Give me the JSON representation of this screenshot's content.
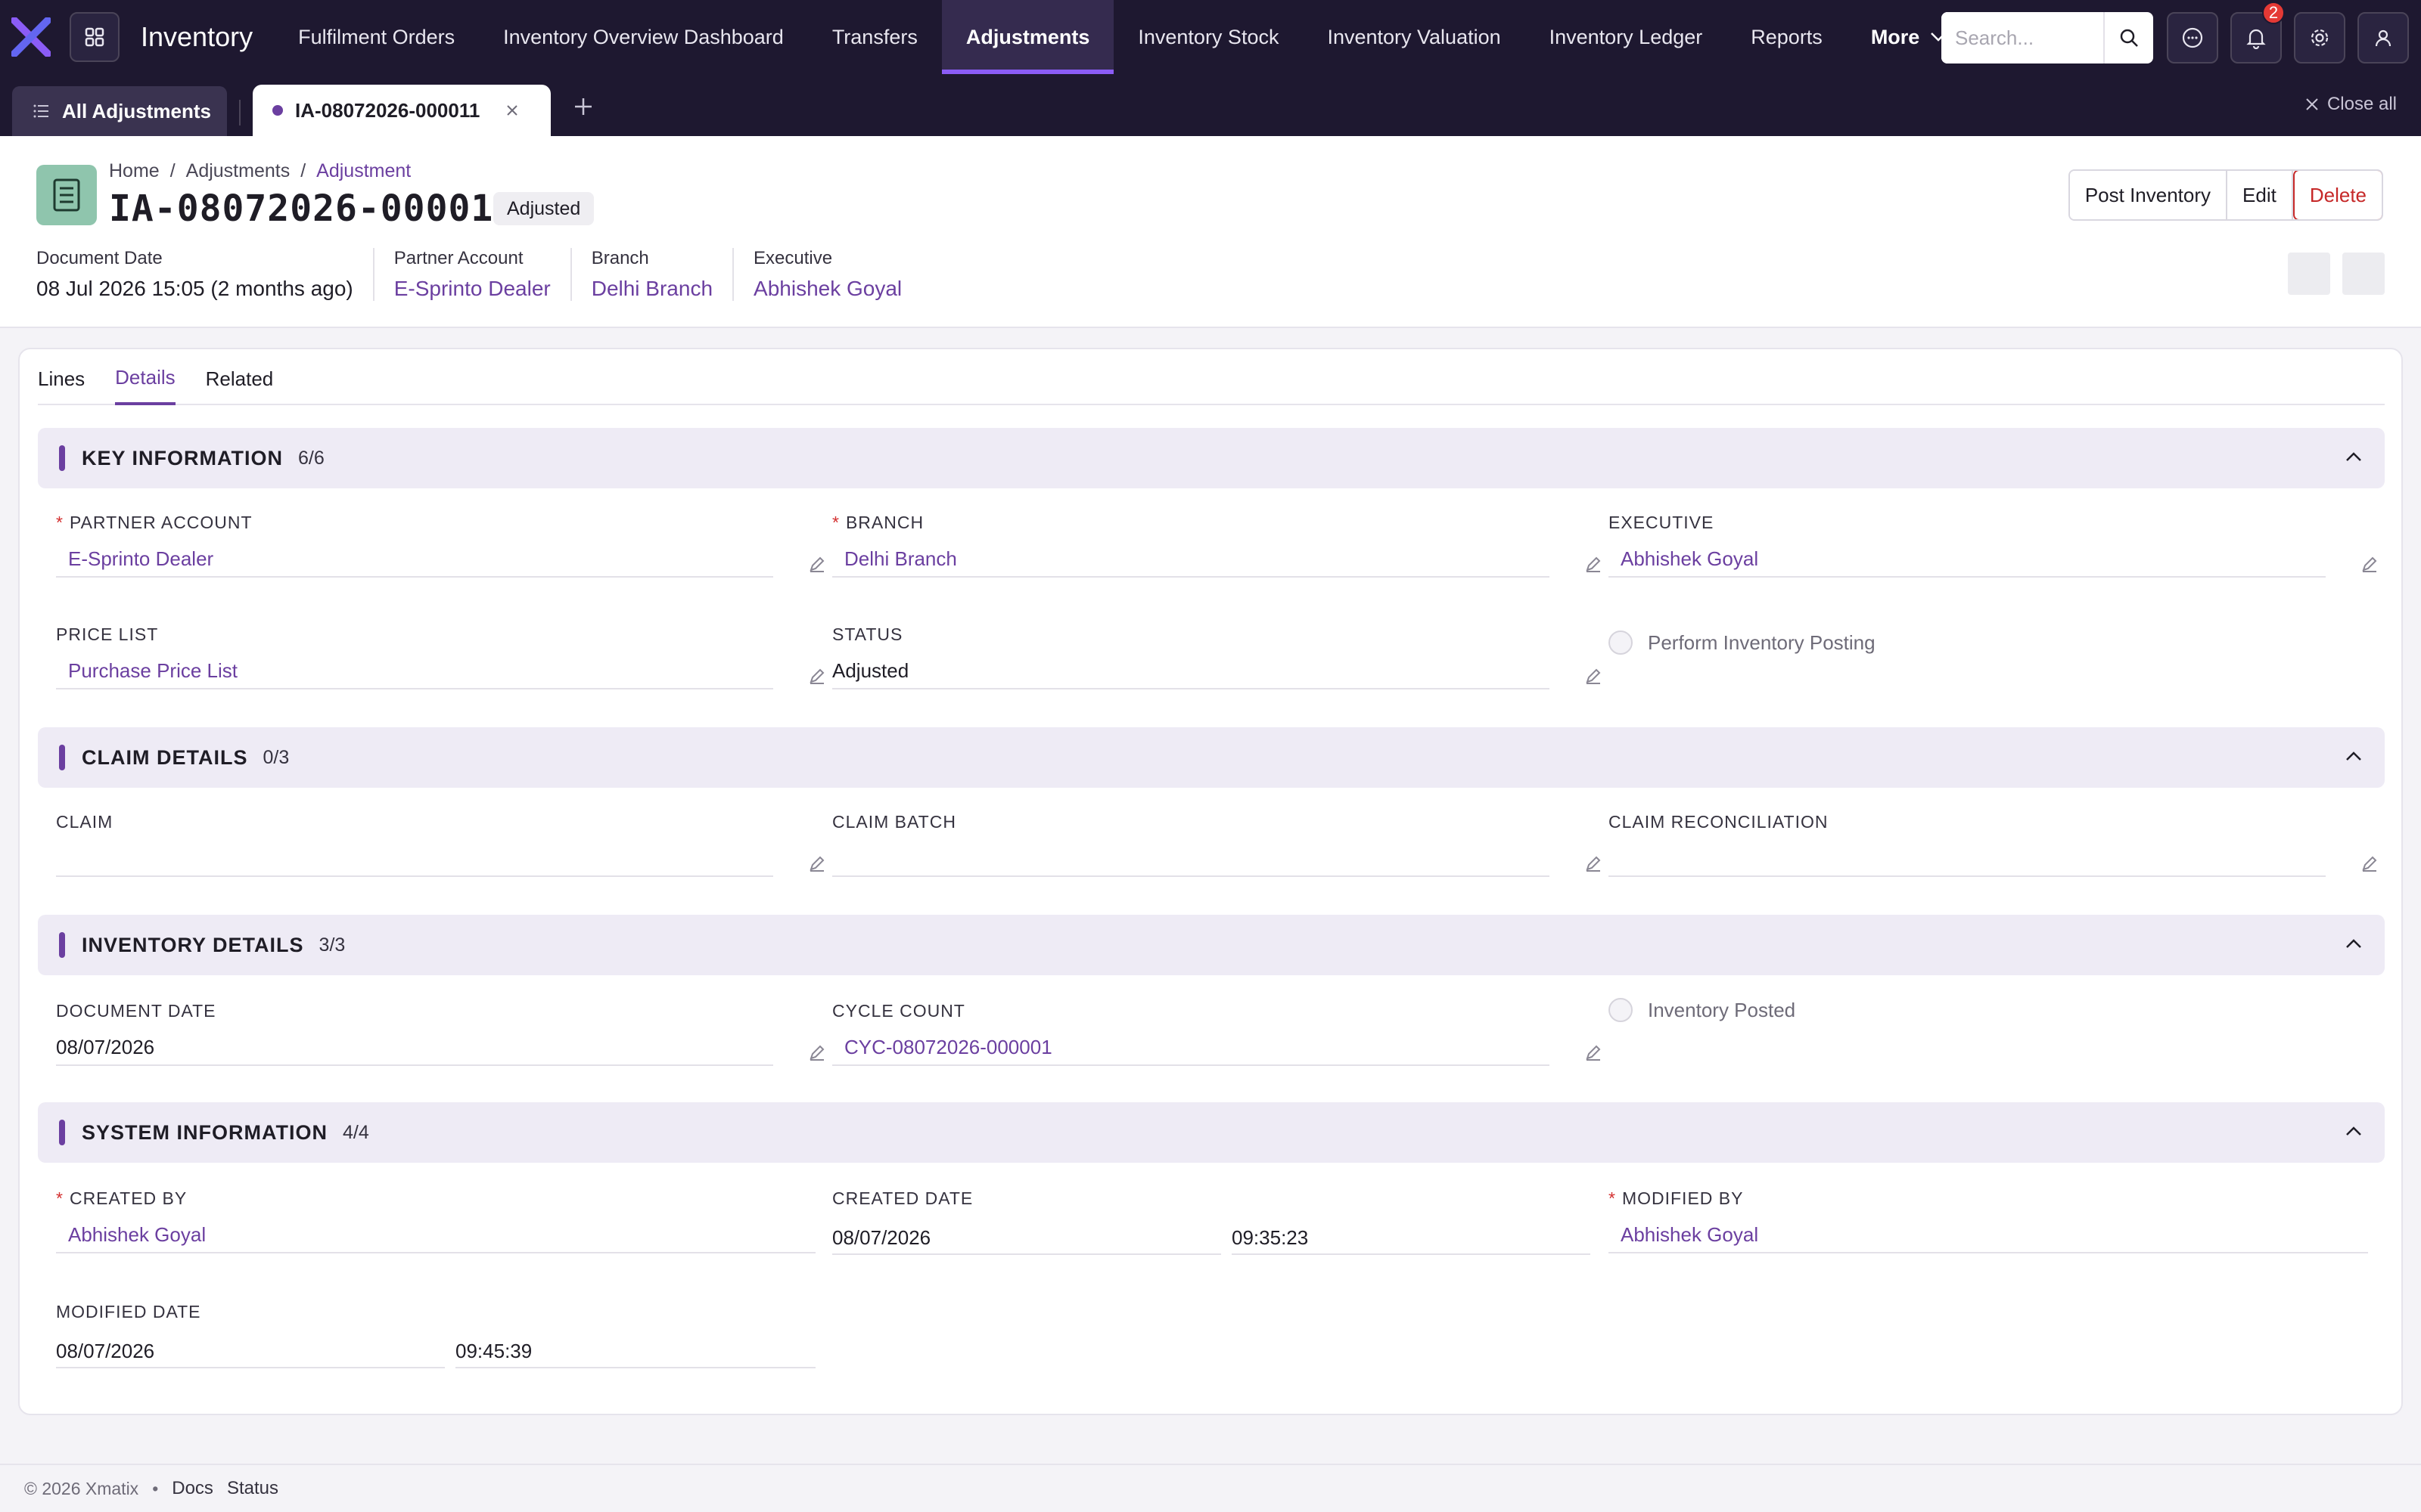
{
  "app": {
    "title": "Inventory",
    "logo_icon": "xmatix-x-logo",
    "brand_color": "#6b3fa0"
  },
  "nav": {
    "items": [
      {
        "label": "Fulfilment Orders",
        "active": false
      },
      {
        "label": "Inventory Overview Dashboard",
        "active": false
      },
      {
        "label": "Transfers",
        "active": false
      },
      {
        "label": "Adjustments",
        "active": true
      },
      {
        "label": "Inventory Stock",
        "active": false
      },
      {
        "label": "Inventory Valuation",
        "active": false
      },
      {
        "label": "Inventory Ledger",
        "active": false
      },
      {
        "label": "Reports",
        "active": false
      }
    ],
    "more_label": "More",
    "search_placeholder": "Search...",
    "notification_count": "2"
  },
  "tabbar": {
    "all_label": "All Adjustments",
    "doc_tab_label": "IA-08072026-000011",
    "close_all_label": "Close all"
  },
  "record": {
    "breadcrumb": [
      "Home",
      "Adjustments",
      "Adjustment"
    ],
    "title": "IA-08072026-000011",
    "status": "Adjusted",
    "actions": {
      "post": "Post Inventory",
      "edit": "Edit",
      "delete": "Delete"
    },
    "meta": [
      {
        "label": "Document Date",
        "value": "08 Jul 2026 15:05 (2 months ago)",
        "link": false
      },
      {
        "label": "Partner Account",
        "value": "E-Sprinto Dealer",
        "link": true
      },
      {
        "label": "Branch",
        "value": "Delhi Branch",
        "link": true
      },
      {
        "label": "Executive",
        "value": "Abhishek Goyal",
        "link": true
      }
    ]
  },
  "tabs": [
    "Lines",
    "Details",
    "Related"
  ],
  "active_tab": "Details",
  "sections": {
    "key": {
      "title": "KEY INFORMATION",
      "count": "6/6",
      "fields": {
        "partner_account": {
          "label": "Partner Account",
          "value": "E-Sprinto Dealer"
        },
        "branch": {
          "label": "Branch",
          "value": "Delhi Branch"
        },
        "executive": {
          "label": "Executive",
          "value": "Abhishek Goyal"
        },
        "price_list": {
          "label": "Price List",
          "value": "Purchase Price List"
        },
        "status": {
          "label": "Status",
          "value": "Adjusted"
        },
        "perform_posting": {
          "label": "Perform Inventory Posting"
        }
      }
    },
    "claim": {
      "title": "CLAIM DETAILS",
      "count": "0/3",
      "fields": {
        "claim": {
          "label": "Claim"
        },
        "claim_batch": {
          "label": "Claim Batch"
        },
        "claim_reconciliation": {
          "label": "Claim Reconciliation"
        }
      }
    },
    "inventory": {
      "title": "INVENTORY DETAILS",
      "count": "3/3",
      "fields": {
        "document_date": {
          "label": "Document Date",
          "value": "08/07/2026"
        },
        "cycle_count": {
          "label": "Cycle Count",
          "value": "CYC-08072026-000001"
        },
        "inventory_posted": {
          "label": "Inventory Posted"
        }
      }
    },
    "system": {
      "title": "SYSTEM INFORMATION",
      "count": "4/4",
      "fields": {
        "created_by": {
          "label": "Created By",
          "value": "Abhishek Goyal"
        },
        "created_date": {
          "label": "Created Date",
          "date": "08/07/2026",
          "time": "09:35:23"
        },
        "modified_by": {
          "label": "Modified By",
          "value": "Abhishek Goyal"
        },
        "modified_date": {
          "label": "Modified Date",
          "date": "08/07/2026",
          "time": "09:45:39"
        }
      }
    }
  },
  "footer": {
    "copyright": "© 2026 Xmatix",
    "links": [
      "Docs",
      "Status"
    ]
  }
}
